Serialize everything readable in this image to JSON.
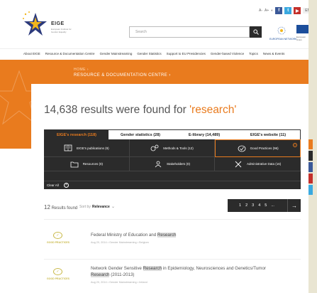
{
  "header": {
    "logo_text": "EIGE",
    "logo_sub": "European Institute for Gender Equality",
    "search_placeholder": "Search",
    "topbar": {
      "a_minus": "A-",
      "a_plus": "A+",
      "lang": "EN"
    },
    "eu_text": "EUROPEAN NETWORK",
    "eu_flag_text": "European Union"
  },
  "nav": [
    "About EIGE",
    "Resource & Documentation Centre",
    "Gender Mainstreaming",
    "Gender Statistics",
    "Support to EU Presidencies",
    "Gender-based Violence",
    "Topics",
    "News & Events"
  ],
  "breadcrumb": {
    "home": "HOME",
    "current": "RESOURCE & DOCUMENTATION CENTRE"
  },
  "results": {
    "count_text": "14,638 results were found for ",
    "query": "'research'"
  },
  "tabs": [
    {
      "label": "EIGE's research (118)",
      "active": true
    },
    {
      "label": "Gender statistics (28)",
      "active": false
    },
    {
      "label": "E-library (14,489)",
      "active": false
    },
    {
      "label": "EIGE's website (11)",
      "active": false
    }
  ],
  "filters": [
    {
      "icon": "book-icon",
      "label": "EIGE's publications (9)"
    },
    {
      "icon": "gears-icon",
      "label": "Methods & Tools (12)"
    },
    {
      "icon": "check-icon",
      "label": "Good Practices (96)",
      "selected": true
    },
    {
      "icon": "folder-icon",
      "label": "Resources (0)"
    },
    {
      "icon": "person-icon",
      "label": "Stakeholders (0)"
    },
    {
      "icon": "tools-icon",
      "label": "Administrative Data (16)"
    }
  ],
  "clear_all": "Clear All",
  "sort": {
    "count_num": "12",
    "count_label": "Results found",
    "by_label": "Sort by",
    "value": "Relevance"
  },
  "pager": {
    "pages": [
      "1",
      "2",
      "3",
      "4",
      "5",
      "..."
    ]
  },
  "items": [
    {
      "badge": "GOOD PRACTICES",
      "title_pre": "Federal Ministry of Education and ",
      "title_hl": "Research",
      "title_post": "",
      "meta": "Aug 20, 2014  •  Gender Mainstreaming  •  Belgium"
    },
    {
      "badge": "GOOD PRACTICES",
      "title_pre": "Network Gender Sensitive ",
      "title_hl": "Research",
      "title_post": " in Epidemiology, Neurosciences and Genetics/Tumor",
      "title_line2_hl": "Research",
      "title_line2": " (2011-2013)",
      "meta": "Aug 20, 2014  •  Gender Mainstreaming  •  Ireland"
    }
  ],
  "colors": {
    "orange": "#e97b1e",
    "dark": "#2b2b2b",
    "gold": "#c9b94a"
  }
}
